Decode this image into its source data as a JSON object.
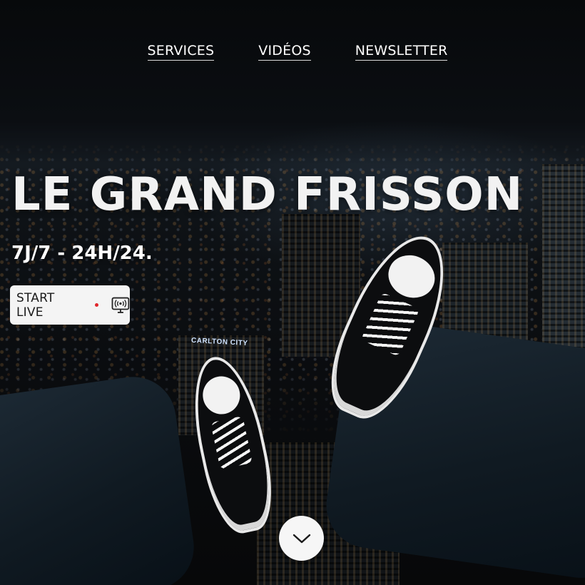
{
  "nav": {
    "items": [
      {
        "label": "SERVICES"
      },
      {
        "label": "VIDÉOS"
      },
      {
        "label": "NEWSLETTER"
      }
    ]
  },
  "hero": {
    "title": "LE GRAND FRISSON",
    "subtitle": "7J/7 - 24H/24.",
    "live_button": {
      "label": "START LIVE",
      "icon": "broadcast-monitor-icon",
      "dot_color": "#e0262b"
    },
    "scroll_button": {
      "icon": "chevron-down-icon"
    },
    "background_sign": "CARLTON CITY"
  }
}
